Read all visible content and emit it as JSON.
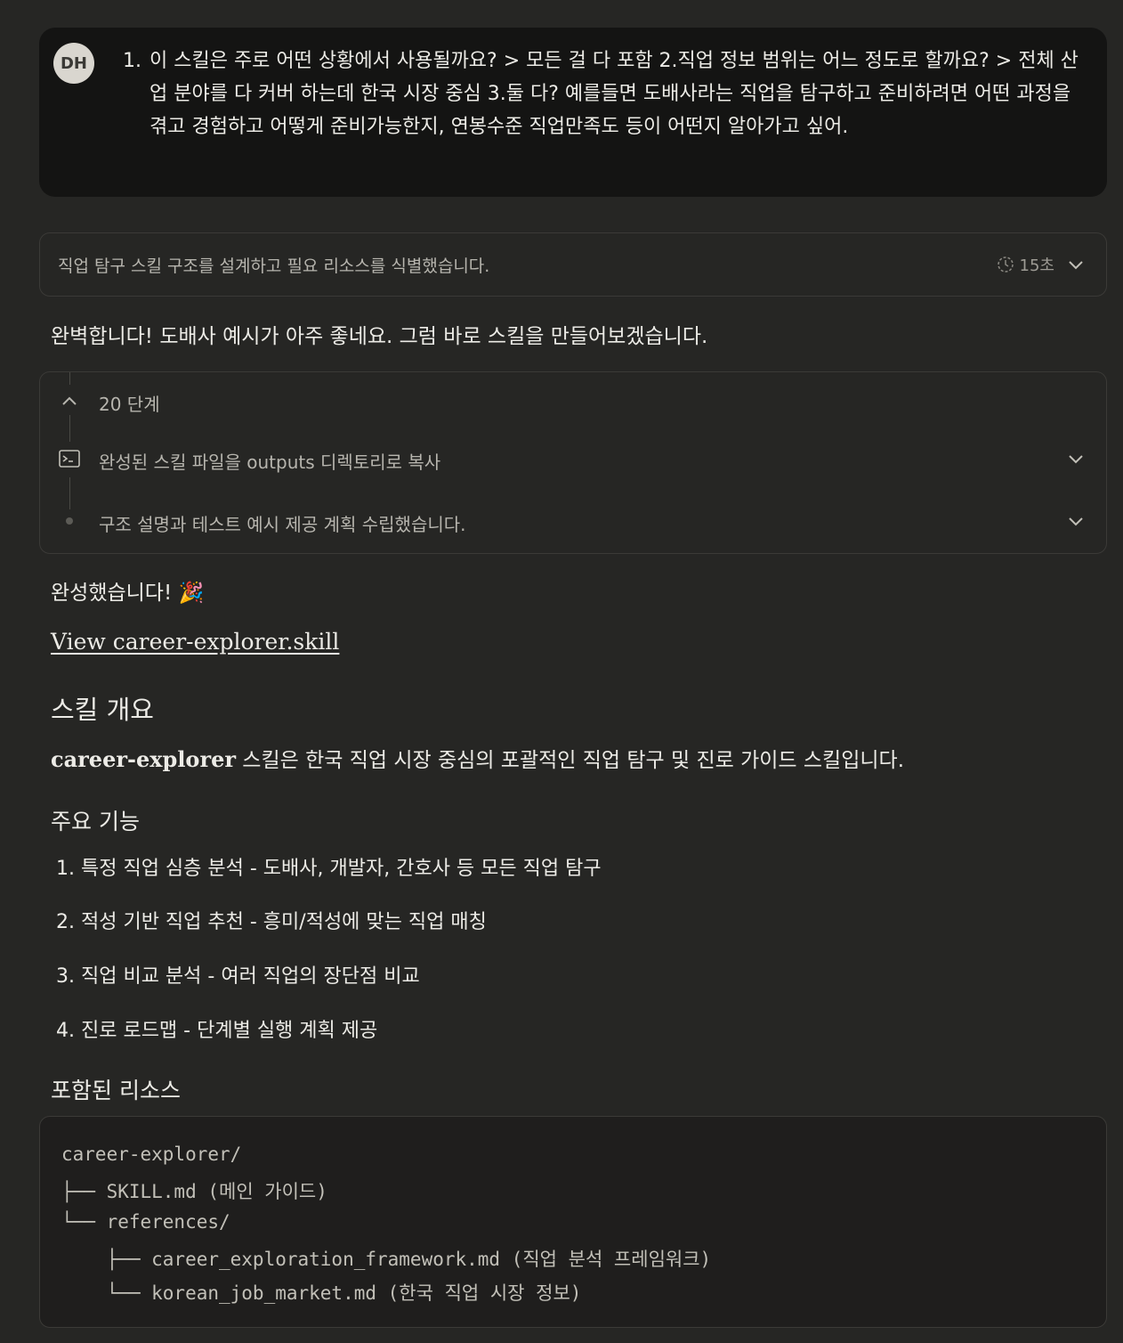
{
  "user_message": {
    "avatar_initials": "DH",
    "number": "1.",
    "text": "이 스킬은 주로 어떤 상황에서 사용될까요? > 모든 걸 다 포함 2.직업 정보 범위는 어느 정도로 할까요? > 전체 산업 분야를 다 커버 하는데 한국 시장 중심 3.둘 다? 예를들면 도배사라는 직업을 탐구하고 준비하려면 어떤 과정을 겪고 경험하고 어떻게 준비가능한지, 연봉수준 직업만족도 등이 어떤지 알아가고 싶어."
  },
  "thinking": {
    "summary": "직업 탐구 스킬 구조를 설계하고 필요 리소스를 식별했습니다.",
    "duration": "15초"
  },
  "reply_intro": "완벽합니다! 도배사 예시가 아주 좋네요. 그럼 바로 스킬을 만들어보겠습니다.",
  "steps": {
    "count_label": "20 단계",
    "items": [
      {
        "label": "완성된 스킬 파일을 outputs 디렉토리로 복사",
        "icon": "terminal-icon"
      },
      {
        "label": "구조 설명과 테스트 예시 제공 계획 수립했습니다.",
        "icon": "dot-icon"
      }
    ]
  },
  "done_text": "완성했습니다! 🎉",
  "skill_link": "View career-explorer.skill",
  "overview": {
    "heading": "스킬 개요",
    "name": "career-explorer",
    "description": " 스킬은 한국 직업 시장 중심의 포괄적인 직업 탐구 및 진로 가이드 스킬입니다."
  },
  "features": {
    "heading": "주요 기능",
    "items": [
      "1. 특정 직업 심층 분석 - 도배사, 개발자, 간호사 등 모든 직업 탐구",
      "2. 적성 기반 직업 추천 - 흥미/적성에 맞는 직업 매칭",
      "3. 직업 비교 분석 - 여러 직업의 장단점 비교",
      "4. 진로 로드맵 - 단계별 실행 계획 제공"
    ]
  },
  "resources": {
    "heading": "포함된 리소스",
    "tree": [
      "career-explorer/",
      "├── SKILL.md (메인 가이드)",
      "└── references/",
      "    ├── career_exploration_framework.md (직업 분석 프레임워크)",
      "    └── korean_job_market.md (한국 직업 시장 정보)"
    ]
  }
}
